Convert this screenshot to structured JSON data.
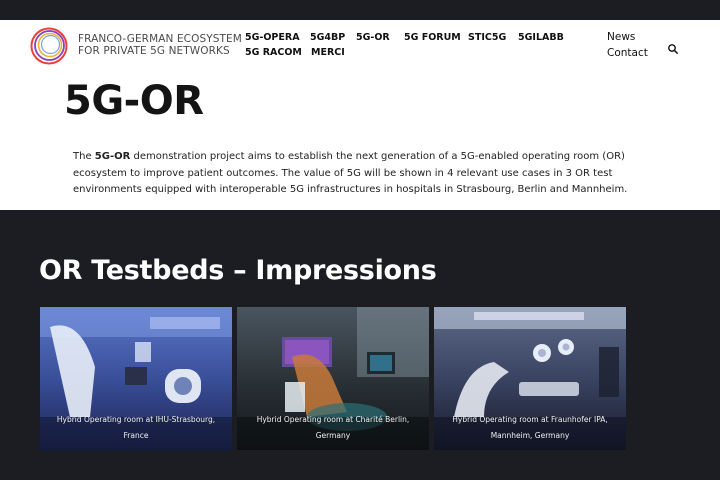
{
  "header": {
    "logo_line1": "FRANCO-GERMAN ECOSYSTEM",
    "logo_line2": "FOR PRIVATE 5G NETWORKS",
    "nav_items": [
      "5G-OPERA",
      "5G4BP",
      "5G-OR",
      "5G FORUM",
      "STIC5G",
      "5GILABB",
      "5G RACOM",
      "MERCI"
    ],
    "right_links": [
      "News",
      "Contact"
    ],
    "search_icon": "search-icon"
  },
  "page": {
    "title": "5G-OR",
    "intro_bold": "5G-OR",
    "intro_prefix": "The ",
    "intro_rest": " demonstration project aims to establish the next generation of a 5G-enabled operating room (OR) ecosystem to improve patient outcomes. The value of 5G will be shown in 4 relevant use cases in 3 OR test environments equipped with interoperable 5G infrastructures in hospitals in Strasbourg, Berlin and Mannheim."
  },
  "testbeds": {
    "title": "OR Testbeds – Impressions",
    "cards": [
      {
        "caption": "Hybrid Operating room at IHU-Strasbourg, France"
      },
      {
        "caption": "Hybrid Operating room at Charité Berlin, Germany"
      },
      {
        "caption": "Hybrid Operating room at Fraunhofer IPA, Mannheim, Germany"
      }
    ]
  },
  "colors": {
    "dark_bg": "#1b1d22",
    "white_bg": "#ffffff",
    "logo_ring_outer": "#e8413a",
    "logo_ring_mid": "#8a3fbf",
    "logo_ring_inner": "#f2b233"
  }
}
